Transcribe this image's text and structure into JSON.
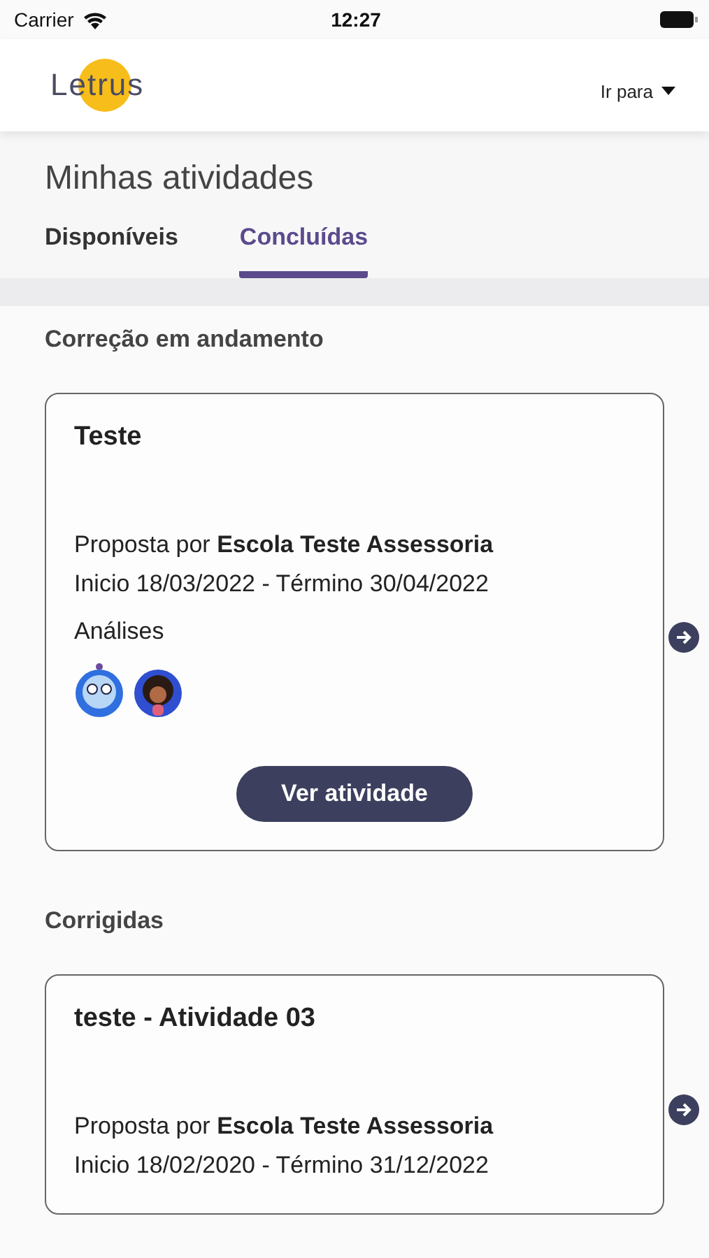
{
  "status_bar": {
    "carrier": "Carrier",
    "time": "12:27"
  },
  "header": {
    "logo": "Letrus",
    "menu": "Ir para"
  },
  "page_title": "Minhas atividades",
  "tabs": [
    {
      "label": "Disponíveis",
      "selected": false
    },
    {
      "label": "Concluídas",
      "selected": true
    }
  ],
  "sections": [
    {
      "title": "Correção em andamento",
      "card": {
        "title": "Teste",
        "proposed_label": "Proposta por",
        "school": "Escola Teste Assessoria",
        "dates": "Inicio 18/03/2022 - Término 30/04/2022",
        "analyses_label": "Análises",
        "avatars": [
          {
            "kind": "robot"
          },
          {
            "kind": "person"
          }
        ],
        "button": "Ver atividade"
      }
    },
    {
      "title": "Corrigidas",
      "card": {
        "title": "teste - Atividade 03",
        "proposed_label": "Proposta por",
        "school": "Escola Teste Assessoria",
        "dates": "Inicio 18/02/2020 - Término 31/12/2022"
      }
    }
  ]
}
